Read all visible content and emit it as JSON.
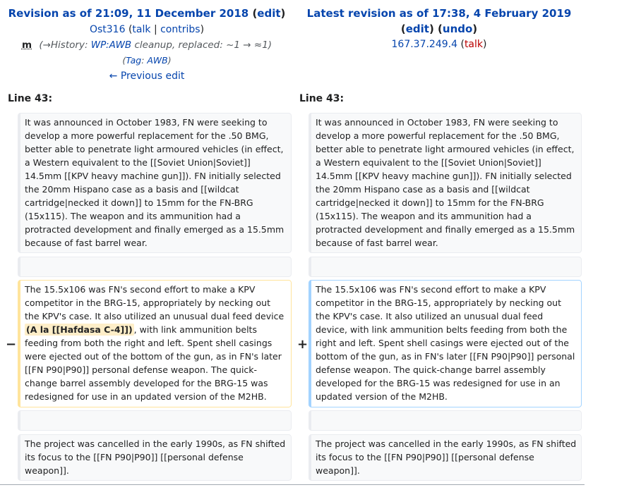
{
  "left": {
    "title_prefix": "Revision as of 21:09, 11 December 2018",
    "edit": "edit",
    "user": "Ost316",
    "talk": "talk",
    "contribs": "contribs",
    "minor": "m",
    "summary_arrow": "(→",
    "summary_section": "History",
    "summary_colon": ": ",
    "summary_link": "WP:AWB",
    "summary_rest": " cleanup, replaced: ~1 → ≈1)",
    "tag_open": "(",
    "tag_label": "Tag",
    "tag_colon": ": ",
    "tag_value": "AWB",
    "tag_close": ")",
    "prev_edit": "← Previous edit",
    "line_label": "Line 43:"
  },
  "right": {
    "title_prefix": "Latest revision as of 17:38, 4 February 2019",
    "edit": "edit",
    "undo": "undo",
    "ip": "167.37.249.4",
    "talk": "talk",
    "line_label": "Line 43:"
  },
  "para1": "It was announced in October 1983, FN were seeking to develop a more powerful replacement for the .50 BMG, better able to penetrate light armoured vehicles (in effect, a Western equivalent to the [[Soviet Union|Soviet]] 14.5mm [[KPV heavy machine gun]]). FN initially selected the 20mm Hispano case as a basis and [[wildcat cartridge|necked it down]] to 15mm for the FN-BRG (15x115). The weapon and its ammunition had a protracted development and finally emerged as a 15.5mm because of fast barrel wear.",
  "deleted": {
    "marker": "−",
    "before": "The 15.5x106 was FN's second effort to make a KPV competitor in the BRG-15, appropriately by necking out the KPV's case. It also utilized an unusual dual feed device ",
    "highlight": "(A la [[Hafdasa C-4]])",
    "after": ", with link ammunition belts feeding from both the right and left. Spent shell casings were ejected out of the bottom of the gun, as in FN's later [[FN P90|P90]] personal defense weapon. The quick-change barrel assembly developed for the BRG-15 was redesigned for use in an updated version of the M2HB."
  },
  "added": {
    "marker": "+",
    "text": "The 15.5x106 was FN's second effort to make a KPV competitor in the BRG-15, appropriately by necking out the KPV's case. It also utilized an unusual dual feed device, with link ammunition belts feeding from both the right and left. Spent shell casings were ejected out of the bottom of the gun, as in FN's later [[FN P90|P90]] personal defense weapon. The quick-change barrel assembly developed for the BRG-15 was redesigned for use in an updated version of the M2HB."
  },
  "para3": "The project was cancelled in the early 1990s, as FN shifted its focus to the [[FN P90|P90]] [[personal defense weapon]].",
  "colors": {
    "link": "#0645ad",
    "redlink": "#ba0000",
    "deleted_border": "#ffe49c",
    "added_border": "#a3d3ff",
    "highlight_bg": "#feeec8"
  }
}
